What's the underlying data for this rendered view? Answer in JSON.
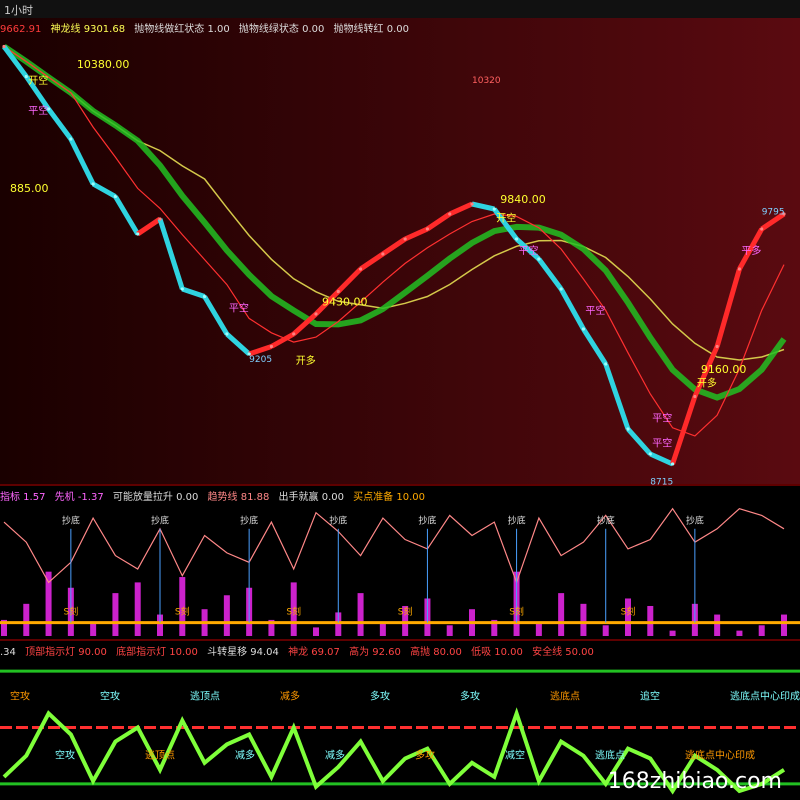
{
  "period_label": "1小时",
  "watermark": "168zhibiao.com",
  "panel1_legend": [
    {
      "text": "9662.91",
      "color": "#ff3b3b"
    },
    {
      "text": "神龙线 9301.68",
      "color": "#ffff55"
    },
    {
      "text": "抛物线做红状态 1.00",
      "color": "#dddddd"
    },
    {
      "text": "抛物线绿状态 0.00",
      "color": "#dddddd"
    },
    {
      "text": "抛物线转红 0.00",
      "color": "#dddddd"
    }
  ],
  "panel2_legend": [
    {
      "text": "指标 1.57",
      "color": "#ff66ff"
    },
    {
      "text": "先机 -1.37",
      "color": "#ff66ff"
    },
    {
      "text": "可能放量拉升 0.00",
      "color": "#dddddd"
    },
    {
      "text": "趋势线 81.88",
      "color": "#ff8888"
    },
    {
      "text": "出手就赢 0.00",
      "color": "#dddddd"
    },
    {
      "text": "买点准备 10.00",
      "color": "#ffaa00"
    }
  ],
  "panel3_legend": [
    {
      "text": ".34",
      "color": "#dddddd"
    },
    {
      "text": "顶部指示灯 90.00",
      "color": "#ff4444"
    },
    {
      "text": "底部指示灯 10.00",
      "color": "#ff4444"
    },
    {
      "text": "斗转星移 94.04",
      "color": "#dddddd"
    },
    {
      "text": "神龙 69.07",
      "color": "#ff4444"
    },
    {
      "text": "高为 92.60",
      "color": "#ff4444"
    },
    {
      "text": "高抛 80.00",
      "color": "#ff4444"
    },
    {
      "text": "低吸 10.00",
      "color": "#ff4444"
    },
    {
      "text": "安全线 50.00",
      "color": "#ff4444"
    }
  ],
  "chart_data": [
    {
      "type": "line",
      "series": [
        {
          "values": [
            10450,
            10330,
            10200,
            10080,
            9900,
            9850,
            9700,
            9760,
            9480,
            9450,
            9300,
            9220,
            9250,
            9300,
            9380,
            9470,
            9560,
            9620,
            9680,
            9720,
            9780,
            9820,
            9800,
            9680,
            9600,
            9480,
            9320,
            9180,
            8920,
            8820,
            8780,
            9050,
            9250,
            9560,
            9720,
            9780
          ]
        }
      ],
      "ylim": [
        8700,
        10500
      ],
      "price_labels": [
        {
          "text": "10380.00",
          "i": 3,
          "v": 10380
        },
        {
          "text": "885.00",
          "i": 0,
          "v": 9885
        },
        {
          "text": "10320",
          "i": 21,
          "v": 10320
        },
        {
          "text": "9840.00",
          "i": 22,
          "v": 9840
        },
        {
          "text": "9795",
          "i": 34,
          "v": 9795
        },
        {
          "text": "9205",
          "i": 11,
          "v": 9205
        },
        {
          "text": "9430.00",
          "i": 14,
          "v": 9430
        },
        {
          "text": "9160.00",
          "i": 31,
          "v": 9160
        },
        {
          "text": "8715",
          "i": 29,
          "v": 8715
        }
      ],
      "signals": [
        {
          "text": "开空",
          "i": 1,
          "v": 10300
        },
        {
          "text": "平空",
          "i": 1,
          "v": 10180
        },
        {
          "text": "平空",
          "i": 10,
          "v": 9390
        },
        {
          "text": "开多",
          "i": 13,
          "v": 9180
        },
        {
          "text": "开空",
          "i": 22,
          "v": 9750
        },
        {
          "text": "平空",
          "i": 23,
          "v": 9620
        },
        {
          "text": "平空",
          "i": 26,
          "v": 9380
        },
        {
          "text": "平空",
          "i": 29,
          "v": 8950
        },
        {
          "text": "平空",
          "i": 29,
          "v": 8850
        },
        {
          "text": "开多",
          "i": 31,
          "v": 9090
        },
        {
          "text": "平多",
          "i": 33,
          "v": 9620
        }
      ]
    },
    {
      "type": "area",
      "ylim": [
        0,
        100
      ],
      "trend_line": [
        85,
        70,
        40,
        55,
        88,
        60,
        50,
        80,
        45,
        75,
        62,
        55,
        85,
        50,
        92,
        78,
        60,
        88,
        72,
        65,
        90,
        75,
        85,
        40,
        88,
        60,
        70,
        90,
        65,
        72,
        95,
        70,
        80,
        95,
        90,
        80
      ],
      "buy_line": 10,
      "bottom_labels": [
        "抄底",
        "抄底",
        "抄底",
        "抄底",
        "抄底",
        "抄底",
        "抄底",
        "抄底"
      ],
      "zone_labels": [
        "S刻",
        "S刻",
        "S刻",
        "S刻",
        "S刻",
        "S刻"
      ]
    },
    {
      "type": "line",
      "ylim": [
        0,
        100
      ],
      "levels": [
        90,
        50,
        10
      ],
      "labels": [
        "空攻",
        "空攻",
        "空攻",
        "逃顶点",
        "逃顶点",
        "减多",
        "减多",
        "减多",
        "多攻",
        "多攻",
        "多攻",
        "减空",
        "逃底点",
        "逃底点",
        "追空",
        "逃底点中心印成",
        "逃底点中心印成"
      ]
    }
  ]
}
